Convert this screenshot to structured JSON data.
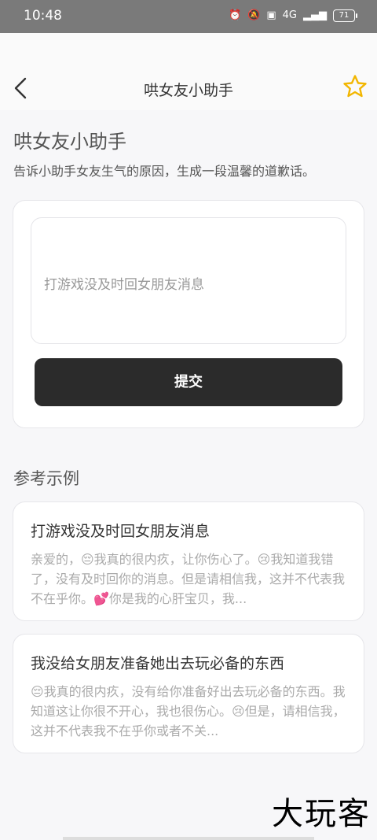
{
  "status": {
    "time": "10:48",
    "network": "4G",
    "battery": "71"
  },
  "nav": {
    "title": "哄女友小助手"
  },
  "header": {
    "title": "哄女友小助手",
    "subtitle": "告诉小助手女友生气的原因，生成一段温馨的道歉话。"
  },
  "form": {
    "placeholder": "打游戏没及时回女朋友消息",
    "submit_label": "提交"
  },
  "examples": {
    "section_title": "参考示例",
    "items": [
      {
        "title": "打游戏没及时回女朋友消息",
        "body": "亲爱的，😔我真的很内疚，让你伤心了。😢我知道我错了，没有及时回你的消息。但是请相信我，这并不代表我不在乎你。💕你是我的心肝宝贝，我..."
      },
      {
        "title": "我没给女朋友准备她出去玩必备的东西",
        "body": "😔我真的很内疚，没有给你准备好出去玩必备的东西。我知道这让你很不开心，我也很伤心。😢但是，请相信我，这并不代表我不在乎你或者不关..."
      }
    ]
  },
  "watermark": "大玩客",
  "colors": {
    "accent": "#f2b600",
    "button": "#2b2b2b"
  }
}
